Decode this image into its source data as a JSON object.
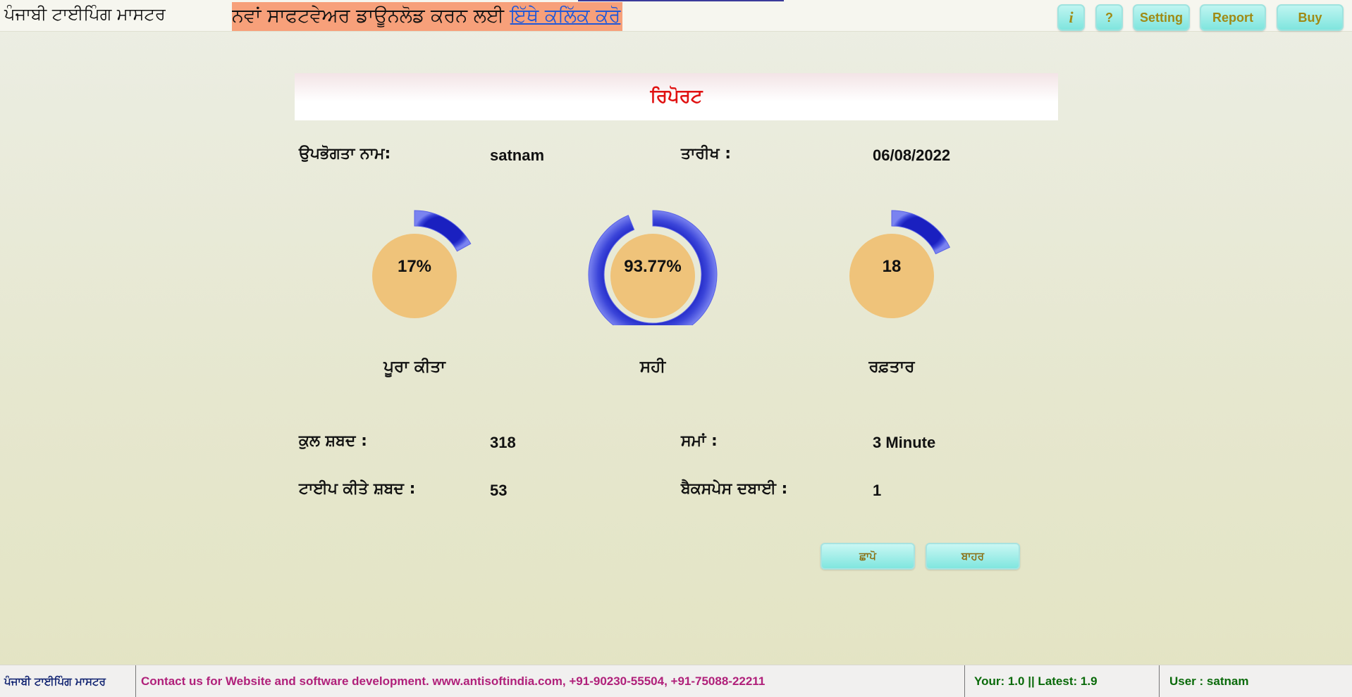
{
  "topbar": {
    "app_title": "ਪੰਜਾਬੀ ਟਾਈਪਿੰਗ ਮਾਸਟਰ",
    "promo_text": "ਨਵਾਂ ਸਾਫਟਵੇਅਰ ਡਾਊਨਲੋਡ ਕਰਨ ਲਈ ",
    "promo_link": "ਇੱਥੇ ਕਲਿੱਕ ਕਰੋ",
    "buttons": {
      "info": "i",
      "help": "?",
      "setting": "Setting",
      "report": "Report",
      "buy": "Buy"
    }
  },
  "report": {
    "title": "ਰਿਪੋਰਟ",
    "user_label": "ਉਪਭੋਗਤਾ ਨਾਮ:",
    "user_value": "satnam",
    "date_label": "ਤਾਰੀਖ :",
    "date_value": "06/08/2022",
    "gauges": [
      {
        "value_text": "17%",
        "fraction": 0.17,
        "caption": "ਪੂਰਾ ਕੀਤਾ"
      },
      {
        "value_text": "93.77%",
        "fraction": 0.9377,
        "caption": "ਸਹੀ"
      },
      {
        "value_text": "18",
        "fraction": 0.18,
        "caption": "ਰਫ਼ਤਾਰ"
      }
    ],
    "total_words_label": "ਕੁਲ ਸ਼ਬਦ :",
    "total_words_value": "318",
    "time_label": "ਸਮਾਂ :",
    "time_value": "3 Minute",
    "typed_words_label": "ਟਾਈਪ ਕੀਤੇ ਸ਼ਬਦ :",
    "typed_words_value": "53",
    "backspace_label": "ਬੈਕਸਪੇਸ ਦਬਾਈ :",
    "backspace_value": "1",
    "print_button": "ਛਾਪੋ",
    "exit_button": "ਬਾਹਰ"
  },
  "colors": {
    "gauge_ring": "#3b45d9",
    "gauge_center": "#efc37a",
    "title_red": "#e01010",
    "promo_bg": "#f7a07a"
  },
  "footer": {
    "app_name": "ਪੰਜਾਬੀ ਟਾਈਪਿੰਗ ਮਾਸਟਰ",
    "contact": "Contact us for Website and software development. www.antisoftindia.com, +91-90230-55504, +91-75088-22211",
    "version": "Your: 1.0 || Latest: 1.9",
    "user": "User : satnam"
  }
}
